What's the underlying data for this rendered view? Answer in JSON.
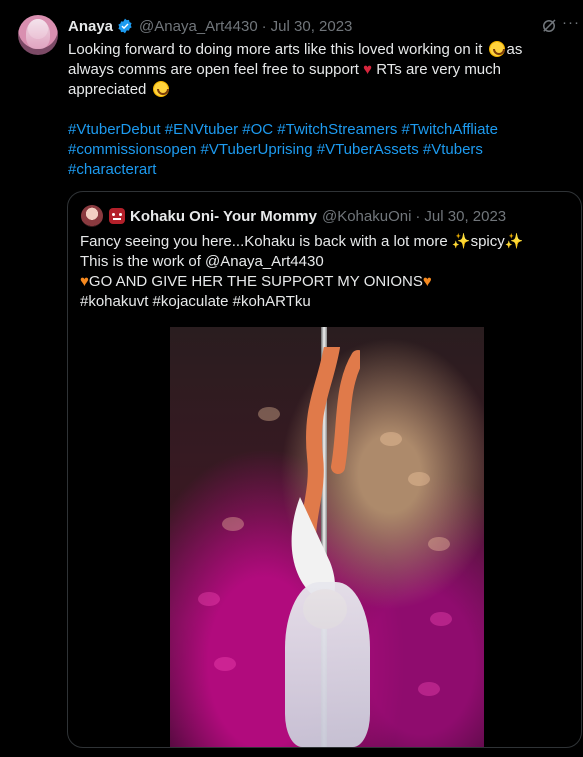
{
  "tweet": {
    "name": "Anaya",
    "handle": "@Anaya_Art4430",
    "separator": "·",
    "date": "Jul 30, 2023",
    "text_line1": "Looking forward to doing more arts like this loved working on it",
    "text_line2a": "as",
    "text_line2b": "always comms are open feel free to support",
    "text_line2c": "RTs are very much",
    "text_line3": "appreciated",
    "hashtags_line1": "#VtuberDebut #ENVtuber #OC #TwitchStreamers #TwitchAffliate",
    "hashtags_line2": "#commissionsopen #VTuberUprising #VTuberAssets #Vtubers",
    "hashtags_line3": "#characterart"
  },
  "quote": {
    "name": "Kohaku Oni- Your Mommy",
    "handle": "@KohakuOni",
    "separator": "·",
    "date": "Jul 30, 2023",
    "line1_a": "Fancy seeing you here...Kohaku is back with a lot more",
    "line1_b": "spicy",
    "line2": "This is the work of @Anaya_Art4430",
    "line3": "GO AND GIVE  HER THE SUPPORT MY ONIONS",
    "line4": "#kohakuvt #kojaculate #kohARTku"
  },
  "icons": {
    "verified": "verified-badge-icon",
    "grok": "grok-icon",
    "more": "more-icon",
    "smile": "smiling-face-emoji",
    "heart": "red-heart-emoji",
    "sparkles": "sparkles-emoji",
    "orange_heart": "orange-heart-emoji",
    "oni": "ogre-emoji"
  },
  "colors": {
    "background": "#000000",
    "text": "#e7e9ea",
    "muted": "#71767b",
    "link": "#1d9bf0",
    "border": "#2f3336"
  }
}
